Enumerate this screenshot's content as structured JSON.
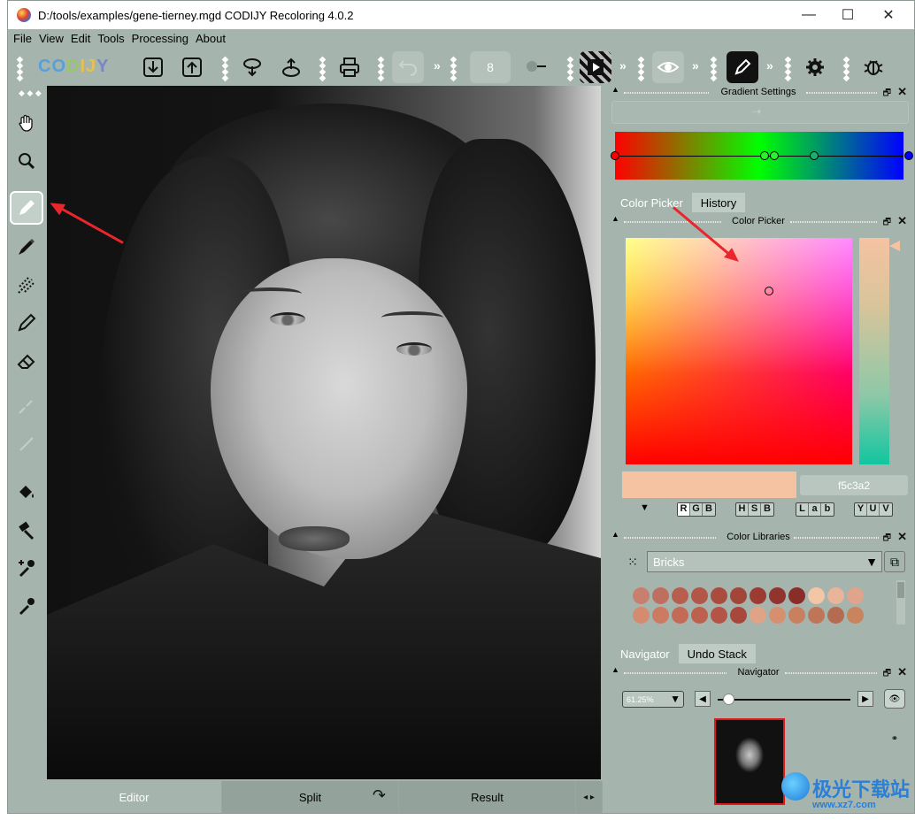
{
  "window": {
    "title": "D:/tools/examples/gene-tierney.mgd CODIJY Recoloring 4.0.2",
    "controls": {
      "minimize": "—",
      "maximize": "☐",
      "close": "✕"
    }
  },
  "menu": [
    "File",
    "View",
    "Edit",
    "Tools",
    "Processing",
    "About"
  ],
  "toolbar": {
    "logo": {
      "c1": "CO",
      "c2": "D",
      "c3": "IJ",
      "c4": "Y"
    },
    "brush_size": "8",
    "chevron": "»",
    "icons": [
      "import-icon",
      "export-icon",
      "load-ribbon-icon",
      "save-ribbon-icon",
      "print-icon",
      "undo-icon",
      "play-icon",
      "eye-icon",
      "pen-icon",
      "settings-icon",
      "bug-icon"
    ]
  },
  "left_tools": [
    "hand-tool",
    "zoom-tool",
    "pencil-tool",
    "marker-tool",
    "pattern-brush-tool",
    "thin-pen-tool",
    "eraser-tool",
    "grayed-pen-tool",
    "grayed-line-tool",
    "fill-bucket-tool",
    "hammer-tool",
    "dropper-plus-tool",
    "dropper-tool"
  ],
  "bottom_tabs": {
    "editor": "Editor",
    "split": "Split",
    "result": "Result"
  },
  "panels": {
    "gradient": {
      "title": "Gradient Settings"
    },
    "tabs1": {
      "color_picker": "Color Picker",
      "history": "History"
    },
    "color_picker": {
      "title": "Color Picker",
      "hex": "f5c3a2",
      "current_color": "#f5c3a2"
    },
    "modes": {
      "rgb": [
        "R",
        "G",
        "B"
      ],
      "hsb": [
        "H",
        "S",
        "B"
      ],
      "lab": [
        "L",
        "a",
        "b"
      ],
      "yuv": [
        "Y",
        "U",
        "V"
      ]
    },
    "color_libraries": {
      "title": "Color Libraries",
      "selected": "Bricks",
      "row1": [
        "#c87f6e",
        "#bf6f5f",
        "#b85e4f",
        "#b25647",
        "#a94b3e",
        "#a3463a",
        "#9b3b32",
        "#90342d",
        "#8a2d28",
        "#f2c6a6",
        "#e9b59a",
        "#e0a38b"
      ],
      "row2": [
        "#d58b6f",
        "#cd7a63",
        "#c46b57",
        "#bd614e",
        "#b45446",
        "#a8473c",
        "#e1a385",
        "#d7906f",
        "#c9805f",
        "#bf7558",
        "#b56b50",
        "#c9835d"
      ]
    },
    "tabs2": {
      "navigator": "Navigator",
      "undo_stack": "Undo Stack"
    },
    "navigator": {
      "title": "Navigator",
      "zoom": "61.25%"
    }
  },
  "watermark": {
    "text": "极光下载站",
    "url": "www.xz7.com"
  }
}
